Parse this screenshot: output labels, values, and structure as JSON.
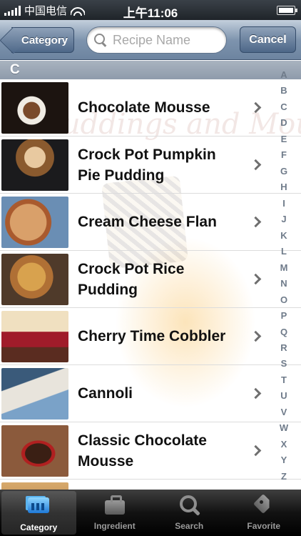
{
  "status_bar": {
    "carrier": "中国电信",
    "time": "上午11:06"
  },
  "nav": {
    "back_label": "Category",
    "search_placeholder": "Recipe Name",
    "search_value": "",
    "cancel_label": "Cancel"
  },
  "section": {
    "header": "C"
  },
  "recipes": [
    {
      "title": "Chocolate Mousse",
      "thumb_icon": "chocolate-mousse-photo"
    },
    {
      "title": "Crock Pot Pumpkin Pie Pudding",
      "thumb_icon": "pumpkin-pudding-photo"
    },
    {
      "title": "Cream Cheese Flan",
      "thumb_icon": "flan-photo"
    },
    {
      "title": "Crock Pot Rice Pudding",
      "thumb_icon": "rice-pudding-photo"
    },
    {
      "title": "Cherry Time Cobbler",
      "thumb_icon": "cobbler-photo"
    },
    {
      "title": "Cannoli",
      "thumb_icon": "cannoli-photo"
    },
    {
      "title": "Classic Chocolate Mousse",
      "thumb_icon": "classic-mousse-photo"
    },
    {
      "title": "",
      "thumb_icon": "partial-photo"
    }
  ],
  "index_letters": [
    "A",
    "B",
    "C",
    "D",
    "E",
    "F",
    "G",
    "H",
    "I",
    "J",
    "K",
    "L",
    "M",
    "N",
    "O",
    "P",
    "Q",
    "R",
    "S",
    "T",
    "U",
    "V",
    "W",
    "X",
    "Y",
    "Z"
  ],
  "watermark": "Puddings and Mousses",
  "tabs": [
    {
      "label": "Category",
      "icon": "category-icon",
      "selected": true
    },
    {
      "label": "Ingredient",
      "icon": "briefcase-icon",
      "selected": false
    },
    {
      "label": "Search",
      "icon": "search-icon",
      "selected": false
    },
    {
      "label": "Favorite",
      "icon": "tag-icon",
      "selected": false
    }
  ]
}
